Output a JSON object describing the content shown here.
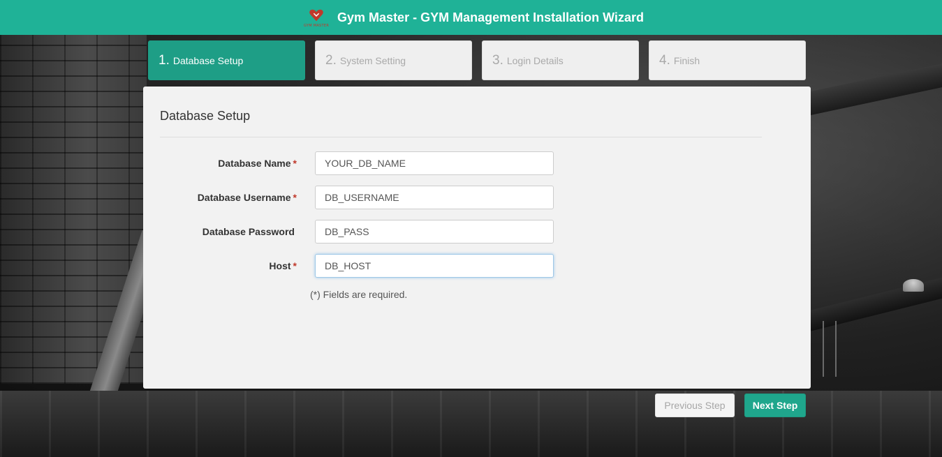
{
  "header": {
    "logo_caption": "GYM MASTER",
    "title": "Gym Master - GYM Management Installation Wizard"
  },
  "steps": [
    {
      "num": "1.",
      "label": "Database Setup",
      "active": true
    },
    {
      "num": "2.",
      "label": "System Setting",
      "active": false
    },
    {
      "num": "3.",
      "label": "Login Details",
      "active": false
    },
    {
      "num": "4.",
      "label": "Finish",
      "active": false
    }
  ],
  "form": {
    "heading": "Database Setup",
    "fields": [
      {
        "label": "Database Name",
        "required_mark": "*",
        "value": "YOUR_DB_NAME"
      },
      {
        "label": "Database Username",
        "required_mark": "*",
        "value": "DB_USERNAME"
      },
      {
        "label": "Database Password",
        "required_mark": "",
        "value": "DB_PASS"
      },
      {
        "label": "Host",
        "required_mark": "*",
        "value": "DB_HOST"
      }
    ],
    "note": "(*) Fields are required."
  },
  "buttons": {
    "previous": "Previous Step",
    "next": "Next Step"
  },
  "colors": {
    "header_bg": "#1fb297",
    "active_step": "#1e9e86",
    "next_button": "#1fa68c",
    "required_mark": "#c0392b"
  }
}
